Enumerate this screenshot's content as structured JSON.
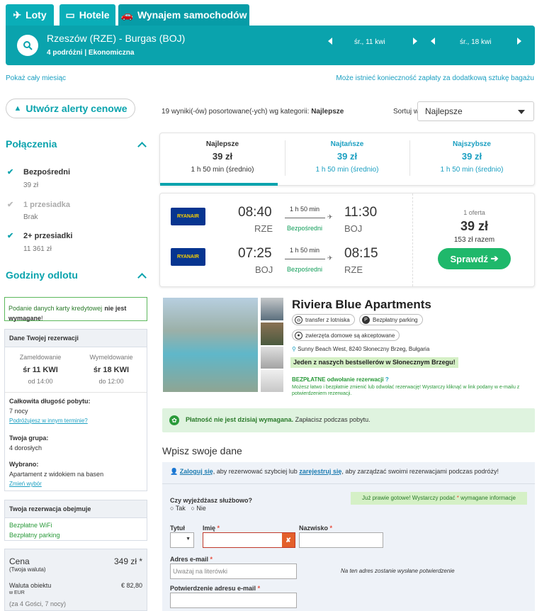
{
  "tabs": [
    {
      "label": "Loty",
      "icon": "plane-icon"
    },
    {
      "label": "Hotele",
      "icon": "bed-icon"
    },
    {
      "label": "Wynajem samochodów",
      "icon": "car-icon"
    }
  ],
  "search": {
    "route": "Rzeszów (RZE) - Burgas (BOJ)",
    "travelers": "4 podróżni",
    "cabin": "Ekonomiczna",
    "date1": "śr., 11 kwi",
    "date2": "śr., 18 kwi"
  },
  "links": {
    "month": "Pokaż cały miesiąc",
    "baggage": "Może istnieć konieczność zapłaty za dodatkową sztukę bagażu"
  },
  "alert_btn": "Utwórz alerty cenowe",
  "results": {
    "count_text": "19 wyniki(-ów) posortowane(-ych) wg kategorii:",
    "sort_key": "Najlepsze",
    "sort_label": "Sortuj wg",
    "sort_value": "Najlepsze"
  },
  "filters": {
    "connections_title": "Połączenia",
    "options": [
      {
        "label": "Bezpośredni",
        "price": "39 zł",
        "checked": true
      },
      {
        "label": "1 przesiadka",
        "price": "Brak",
        "checked": true
      },
      {
        "label": "2+ przesiadki",
        "price": "11 361 zł",
        "checked": true
      }
    ],
    "departure_title": "Godziny odlotu"
  },
  "sort_cols": [
    {
      "name": "Najlepsze",
      "price": "39 zł",
      "time": "1 h 50 min (średnio)"
    },
    {
      "name": "Najtańsze",
      "price": "39 zł",
      "time": "1 h 50 min (średnio)"
    },
    {
      "name": "Najszybsze",
      "price": "39 zł",
      "time": "1 h 50 min (średnio)"
    }
  ],
  "flights": [
    {
      "airline": "RYANAIR",
      "dep": "08:40",
      "dep_ap": "RZE",
      "dur": "1 h 50 min",
      "type": "Bezpośredni",
      "arr": "11:30",
      "arr_ap": "BOJ"
    },
    {
      "airline": "RYANAIR",
      "dep": "07:25",
      "dep_ap": "BOJ",
      "dur": "1 h 50 min",
      "type": "Bezpośredni",
      "arr": "08:15",
      "arr_ap": "RZE"
    }
  ],
  "offer": {
    "count": "1 oferta",
    "price": "39 zł",
    "total": "153 zł razem",
    "button": "Sprawdź"
  },
  "card_notice": {
    "text": "Podanie danych karty kredytowej",
    "bold": "nie jest wymagane",
    "end": "!"
  },
  "booking": {
    "title": "Dane Twojej rezerwacji",
    "checkin_label": "Zameldowanie",
    "checkin": "śr 11 KWI",
    "checkin_from": "od 14:00",
    "checkout_label": "Wymeldowanie",
    "checkout": "śr 18 KWI",
    "checkout_to": "do 12:00",
    "total_label": "Całkowita długość pobytu:",
    "total": "7 nocy",
    "other": "Podróżujesz w innym terminie?",
    "group_label": "Twoja grupa:",
    "group": "4 dorosłych",
    "chosen_label": "Wybrano:",
    "chosen": "Apartament z widokiem na basen",
    "change": "Zmień wybór"
  },
  "includes": {
    "title": "Twoja rezerwacja obejmuje",
    "items": [
      "Bezpłatne WiFi",
      "Bezpłatny parking"
    ]
  },
  "price": {
    "label": "Cena",
    "sub": "(Twoja waluta)",
    "value": "349 zł *",
    "cur_label": "Waluta obiektu",
    "cur_sub": "w EUR",
    "cur_value": "€ 82,80",
    "guests": "(za 4 Gości, 7 nocy)"
  },
  "hotel": {
    "name": "Riviera Blue Apartments",
    "f1": "transfer z lotniska",
    "f2": "Bezpłatny parking",
    "f3": "zwierzęta domowe są akceptowane",
    "address": "Sunny Beach West, 8240 Słoneczny Brzeg, Bułgaria",
    "bestseller": "Jeden z naszych bestsellerów w Słonecznym Brzegu!",
    "free_cancel": "BEZPŁATNE odwołanie rezerwacji",
    "cancel_text": "Możesz łatwo i bezpłatnie zmienić lub odwołać rezerwację! Wystarczy kliknąć w link podany w e-mailu z potwierdzeniem rezerwacji."
  },
  "payment": {
    "bold": "Płatność nie jest dzisiaj wymagana.",
    "rest": "Zapłacisz podczas pobytu."
  },
  "form": {
    "heading": "Wpisz swoje dane",
    "login": "Zaloguj się",
    "t1": ", aby rezerwować szybciej lub",
    "register": "zarejestruj się",
    "t2": ", aby zarządzać swoimi rezerwacjami podczas podróży!",
    "business_q": "Czy wyjeżdżasz służbowo?",
    "yes": "Tak",
    "no": "Nie",
    "ready": "Już prawie gotowe! Wystarczy podać",
    "ready_end": "wymagane informacje",
    "title_label": "Tytuł",
    "first_label": "Imię",
    "last_label": "Nazwisko",
    "email_label": "Adres e-mail",
    "email_ph": "Uważaj na literówki",
    "email_note": "Na ten adres zostanie wysłane potwierdzenie",
    "confirm_label": "Potwierdzenie adresu e-mail"
  },
  "colors": {
    "brand": "#0aa3ad",
    "green": "#1fb86b",
    "link": "#1a9fc1"
  }
}
